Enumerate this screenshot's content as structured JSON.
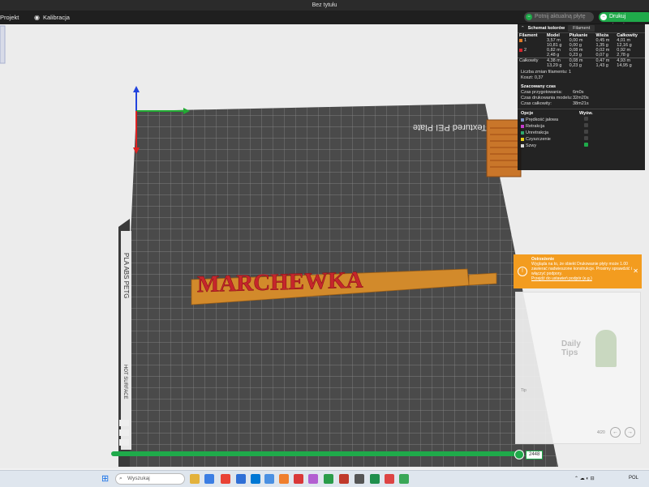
{
  "window": {
    "title": "Bez tytułu"
  },
  "menu": {
    "project": "Projekt",
    "calibration": "Kalibracja"
  },
  "top_actions": {
    "slice_plate": "Potnij aktualną płytę",
    "print_plate": "Drukuj aktualną"
  },
  "plate": {
    "label": "Textured PEI Plate",
    "model_text": "MARCHEWKA",
    "side_label_1": "PLA ABS PETG",
    "side_label_2": "HOT SURFACE"
  },
  "layer_slider": {
    "value": "2448"
  },
  "stats_panel": {
    "scheme_label": "Schemat kolorów",
    "scheme_value": "Filament",
    "columns": [
      "Filament",
      "Model",
      "Płukanie",
      "Wieża",
      "Całkowity"
    ],
    "rows": [
      {
        "id": "1",
        "color": "#e07b2a",
        "model": "3,57 m\n10,81 g",
        "flush": "0,00 m\n0,00 g",
        "tower": "0,45 m\n1,35 g",
        "total": "4,01 m\n12,16 g"
      },
      {
        "id": "2",
        "color": "#d6262d",
        "model": "0,82 m\n2,48 g",
        "flush": "0,08 m\n0,23 g",
        "tower": "0,02 m\n0,07 g",
        "total": "0,92 m\n2,78 g"
      }
    ],
    "total_row": {
      "label": "Całkowity",
      "model": "4,38 m\n13,29 g",
      "flush": "0,08 m\n0,23 g",
      "tower": "0,47 m\n1,43 g",
      "total": "4,93 m\n14,95 g"
    },
    "filament_changes_label": "Liczba zmian filamentu:",
    "filament_changes_value": "1",
    "cost_label": "Koszt:",
    "cost_value": "0,37",
    "time_section": "Szacowany czas",
    "prep_label": "Czas przygotowania:",
    "prep_value": "6m0s",
    "model_time_label": "Czas drukowania modelu:",
    "model_time_value": "32m20s",
    "total_time_label": "Czas całkowity:",
    "total_time_value": "38m21s",
    "options_header": "Opcje",
    "display_header": "Wyśw.",
    "options": [
      {
        "label": "Prędkość jałowa",
        "color": "#7e94c7"
      },
      {
        "label": "Retrakcja",
        "color": "#c63bd0"
      },
      {
        "label": "Unretrakcja",
        "color": "#2ea86d"
      },
      {
        "label": "Czyszczenie",
        "color": "#e8d21a"
      },
      {
        "label": "Szwy",
        "color": "#d8d8d8"
      }
    ]
  },
  "notification": {
    "title": "Ostrzeżenie",
    "body": "Wygląda na to, że obiekt Drukowanie płyty może 1.00 zawierać nadwieszone konstrukcje. Prosimy sprawdzić i włączyć podpory.",
    "link": "Przejdź do ustawień podpór (e.g.)"
  },
  "tips": {
    "title": "Daily Tips",
    "hint": "Tip",
    "page": "4/20"
  },
  "taskbar": {
    "search_placeholder": "Wyszukaj",
    "lang": "POL"
  }
}
